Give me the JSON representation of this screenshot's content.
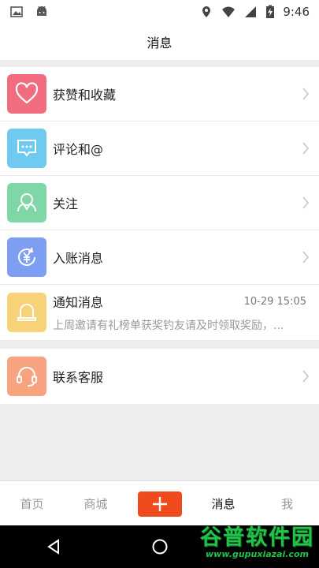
{
  "status": {
    "time": "9:46"
  },
  "header": {
    "title": "消息"
  },
  "items": [
    {
      "label": "获赞和收藏",
      "icon": "heart-icon",
      "color": "#f26c7f"
    },
    {
      "label": "评论和@",
      "icon": "comment-icon",
      "color": "#6ecbef"
    },
    {
      "label": "关注",
      "icon": "follow-user-icon",
      "color": "#7fd6a7"
    },
    {
      "label": "入账消息",
      "icon": "yen-coin-icon",
      "color": "#7d9ef2"
    }
  ],
  "notice": {
    "title": "通知消息",
    "time": "10-29 15:05",
    "message": "上周邀请有礼榜单获奖钓友请及时领取奖励，...",
    "icon": "bell-icon",
    "color": "#f7d278"
  },
  "service": {
    "label": "联系客服",
    "icon": "headset-icon",
    "color": "#f8a37f"
  },
  "tabs": {
    "home": "首页",
    "mall": "商城",
    "messages": "消息",
    "me": "我"
  },
  "watermark": {
    "name": "谷普软件园",
    "url": "www.gupuxiazai.com"
  },
  "colors": {
    "accent": "#f04b1f"
  }
}
